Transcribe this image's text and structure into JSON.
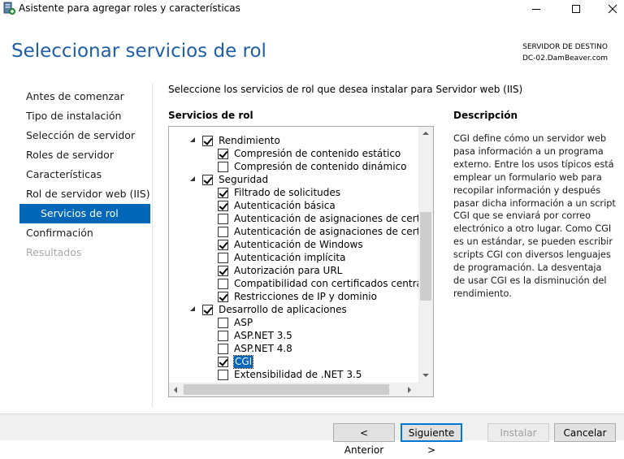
{
  "window": {
    "title": "Asistente para agregar roles y características",
    "icon": "server-manager-icon"
  },
  "header": {
    "page_title": "Seleccionar servicios de rol",
    "destination_label": "SERVIDOR DE DESTINO",
    "destination_server": "DC-02.DamBeaver.com"
  },
  "nav": {
    "items": [
      {
        "label": "Antes de comenzar",
        "state": "normal"
      },
      {
        "label": "Tipo de instalación",
        "state": "normal"
      },
      {
        "label": "Selección de servidor",
        "state": "normal"
      },
      {
        "label": "Roles de servidor",
        "state": "normal"
      },
      {
        "label": "Características",
        "state": "normal"
      },
      {
        "label": "Rol de servidor web (IIS)",
        "state": "normal"
      },
      {
        "label": "Servicios de rol",
        "state": "selected"
      },
      {
        "label": "Confirmación",
        "state": "normal"
      },
      {
        "label": "Resultados",
        "state": "disabled"
      }
    ]
  },
  "main": {
    "instruction": "Seleccione los servicios de rol que desea instalar para Servidor web (IIS)",
    "services_header": "Servicios de rol",
    "tree": [
      {
        "label": "Rendimiento",
        "level": 0,
        "checked": true,
        "expanded": true
      },
      {
        "label": "Compresión de contenido estático",
        "level": 1,
        "checked": true
      },
      {
        "label": "Compresión de contenido dinámico",
        "level": 1,
        "checked": false
      },
      {
        "label": "Seguridad",
        "level": 0,
        "checked": true,
        "expanded": true
      },
      {
        "label": "Filtrado de solicitudes",
        "level": 1,
        "checked": true
      },
      {
        "label": "Autenticación básica",
        "level": 1,
        "checked": true
      },
      {
        "label": "Autenticación de asignaciones de certificad",
        "level": 1,
        "checked": false
      },
      {
        "label": "Autenticación de asignaciones de certificad",
        "level": 1,
        "checked": false
      },
      {
        "label": "Autenticación de Windows",
        "level": 1,
        "checked": true
      },
      {
        "label": "Autenticación implícita",
        "level": 1,
        "checked": false
      },
      {
        "label": "Autorización para URL",
        "level": 1,
        "checked": true
      },
      {
        "label": "Compatibilidad con certificados centralizad",
        "level": 1,
        "checked": false
      },
      {
        "label": "Restricciones de IP y dominio",
        "level": 1,
        "checked": true
      },
      {
        "label": "Desarrollo de aplicaciones",
        "level": 0,
        "checked": true,
        "expanded": true
      },
      {
        "label": "ASP",
        "level": 1,
        "checked": false
      },
      {
        "label": "ASP.NET 3.5",
        "level": 1,
        "checked": false
      },
      {
        "label": "ASP.NET 4.8",
        "level": 1,
        "checked": false
      },
      {
        "label": "CGI",
        "level": 1,
        "checked": true,
        "highlighted": true
      },
      {
        "label": "Extensibilidad de .NET 3.5",
        "level": 1,
        "checked": false
      }
    ]
  },
  "description": {
    "header": "Descripción",
    "text": "CGI define cómo un servidor web pasa información a un programa externo. Entre los usos típicos está emplear un formulario web para recopilar información y después pasar dicha información a un script CGI que se enviará por correo electrónico a otro lugar. Como CGI es un estándar, se pueden escribir scripts CGI con diversos lenguajes de programación. La desventaja de usar CGI es la disminución del rendimiento."
  },
  "footer": {
    "back_label": "< Anterior",
    "next_label": "Siguiente >",
    "install_label": "Instalar",
    "cancel_label": "Cancelar"
  },
  "colors": {
    "accent": "#0067b8",
    "title": "#1e5fa5"
  }
}
